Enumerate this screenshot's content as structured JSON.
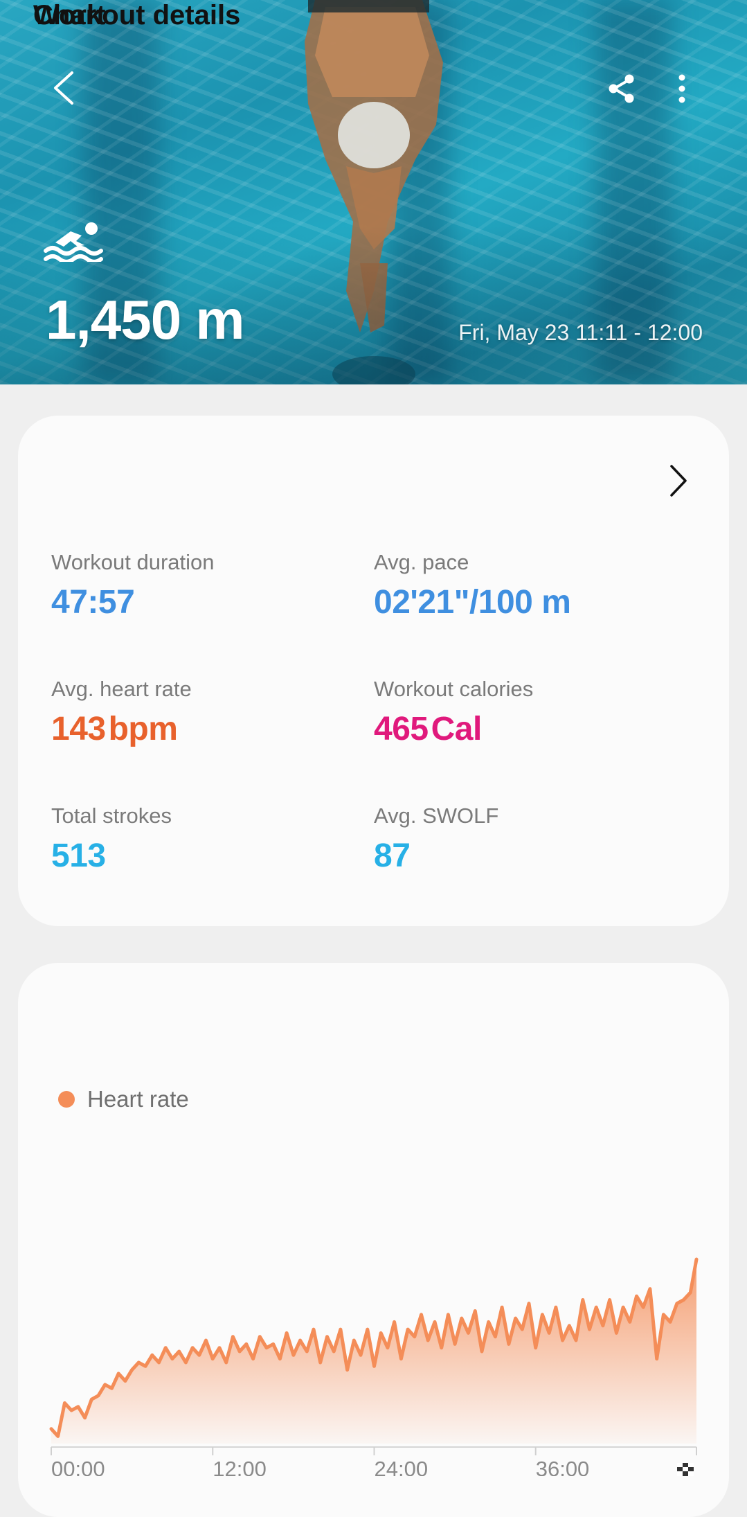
{
  "hero": {
    "distance": "1,450 m",
    "datetime": "Fri, May 23 11:11 - 12:00",
    "icons": {
      "back": "chevron-left-icon",
      "share": "share-icon",
      "more": "more-vertical-icon",
      "activity": "swimming-icon"
    }
  },
  "details": {
    "title": "Workout details",
    "metrics": [
      {
        "label": "Workout duration",
        "value": "47:57",
        "unit": "",
        "color": "#3f8fe0"
      },
      {
        "label": "Avg. pace",
        "value": "02'21\"/100 m",
        "unit": "",
        "color": "#3f8fe0"
      },
      {
        "label": "Avg. heart rate",
        "value": "143",
        "unit": "bpm",
        "color": "#e8612c"
      },
      {
        "label": "Workout calories",
        "value": "465",
        "unit": "Cal",
        "color": "#e0197c"
      },
      {
        "label": "Total strokes",
        "value": "513",
        "unit": "",
        "color": "#27b0e6"
      },
      {
        "label": "Avg. SWOLF",
        "value": "87",
        "unit": "",
        "color": "#27b0e6"
      }
    ]
  },
  "chart": {
    "title": "Chart",
    "legend": "Heart rate",
    "color": "#f48d58"
  },
  "chart_data": {
    "type": "area",
    "title": "Chart",
    "series": [
      {
        "name": "Heart rate"
      }
    ],
    "x_ticks": [
      "00:00",
      "12:00",
      "24:00",
      "36:00"
    ],
    "end_marker": "finish-flag-icon",
    "x_range_minutes": [
      0,
      47.95
    ],
    "x": [
      0,
      0.5,
      1,
      1.5,
      2,
      2.5,
      3,
      3.5,
      4,
      4.5,
      5,
      5.5,
      6,
      6.5,
      7,
      7.5,
      8,
      8.5,
      9,
      9.5,
      10,
      10.5,
      11,
      11.5,
      12,
      12.5,
      13,
      13.5,
      14,
      14.5,
      15,
      15.5,
      16,
      16.5,
      17,
      17.5,
      18,
      18.5,
      19,
      19.5,
      20,
      20.5,
      21,
      21.5,
      22,
      22.5,
      23,
      23.5,
      24,
      24.5,
      25,
      25.5,
      26,
      26.5,
      27,
      27.5,
      28,
      28.5,
      29,
      29.5,
      30,
      30.5,
      31,
      31.5,
      32,
      32.5,
      33,
      33.5,
      34,
      34.5,
      35,
      35.5,
      36,
      36.5,
      37,
      37.5,
      38,
      38.5,
      39,
      39.5,
      40,
      40.5,
      41,
      41.5,
      42,
      42.5,
      43,
      43.5,
      44,
      44.5,
      45,
      45.5,
      46,
      46.5,
      47,
      47.5,
      47.95
    ],
    "y": [
      0.08,
      0.04,
      0.22,
      0.18,
      0.2,
      0.14,
      0.24,
      0.26,
      0.32,
      0.3,
      0.38,
      0.34,
      0.4,
      0.44,
      0.42,
      0.48,
      0.44,
      0.52,
      0.46,
      0.5,
      0.44,
      0.52,
      0.48,
      0.56,
      0.46,
      0.52,
      0.44,
      0.58,
      0.5,
      0.54,
      0.46,
      0.58,
      0.52,
      0.54,
      0.46,
      0.6,
      0.48,
      0.56,
      0.5,
      0.62,
      0.44,
      0.58,
      0.5,
      0.62,
      0.4,
      0.56,
      0.48,
      0.62,
      0.42,
      0.6,
      0.52,
      0.66,
      0.46,
      0.62,
      0.58,
      0.7,
      0.56,
      0.66,
      0.52,
      0.7,
      0.54,
      0.68,
      0.6,
      0.72,
      0.5,
      0.66,
      0.58,
      0.74,
      0.54,
      0.68,
      0.62,
      0.76,
      0.52,
      0.7,
      0.6,
      0.74,
      0.56,
      0.64,
      0.56,
      0.78,
      0.62,
      0.74,
      0.64,
      0.78,
      0.6,
      0.74,
      0.66,
      0.8,
      0.74,
      0.84,
      0.46,
      0.7,
      0.66,
      0.76,
      0.78,
      0.82,
      1.0
    ],
    "y_note": "relative level read from the plot; no y-axis labels are printed"
  }
}
